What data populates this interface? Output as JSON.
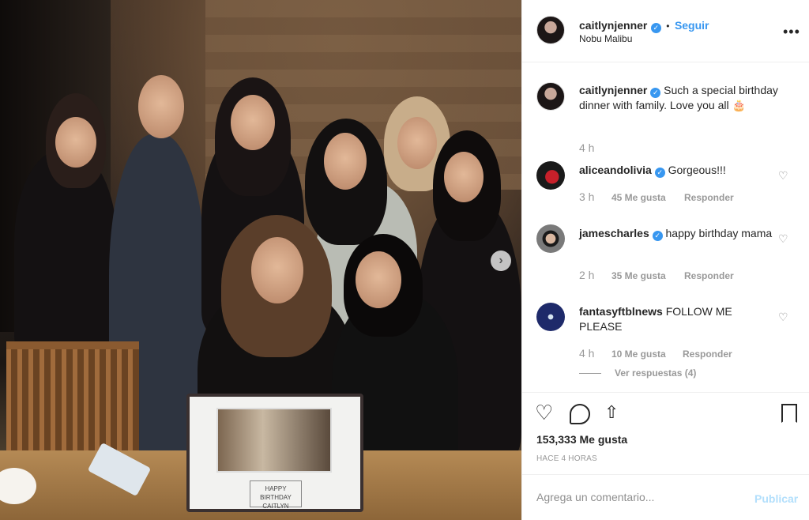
{
  "post": {
    "author": "caitlynjenner",
    "follow_label": "Seguir",
    "separator": "•",
    "location": "Nobu Malibu",
    "more_label": "•••",
    "verified_glyph": "✓"
  },
  "caption": {
    "username": "caitlynjenner",
    "text": "Such a special birthday dinner with family. Love you all 🎂",
    "time": "4 h"
  },
  "comments": [
    {
      "username": "aliceandolivia",
      "verified": true,
      "text": "Gorgeous!!!",
      "time": "3 h",
      "likes": "45 Me gusta",
      "reply": "Responder"
    },
    {
      "username": "jamescharles",
      "verified": true,
      "text": "happy birthday mama",
      "time": "2 h",
      "likes": "35 Me gusta",
      "reply": "Responder"
    },
    {
      "username": "fantasyftblnews",
      "verified": false,
      "text": "FOLLOW ME PLEASE",
      "time": "4 h",
      "likes": "10 Me gusta",
      "reply": "Responder",
      "view_replies": "Ver respuestas (4)"
    }
  ],
  "actions": {
    "likes_count": "153,333 Me gusta",
    "posted": "HACE 4 HORAS"
  },
  "composer": {
    "placeholder": "Agrega un comentario...",
    "publish_label": "Publicar"
  },
  "photo": {
    "cake_text": "HAPPY BIRTHDAY CAITLYN",
    "next_glyph": "›"
  },
  "icons": {
    "heart": "♡",
    "comment": "◯",
    "share": "⇧",
    "bookmark": "⎘"
  },
  "colors": {
    "link_blue": "#3897f0",
    "publish_disabled": "#b2dffc"
  }
}
